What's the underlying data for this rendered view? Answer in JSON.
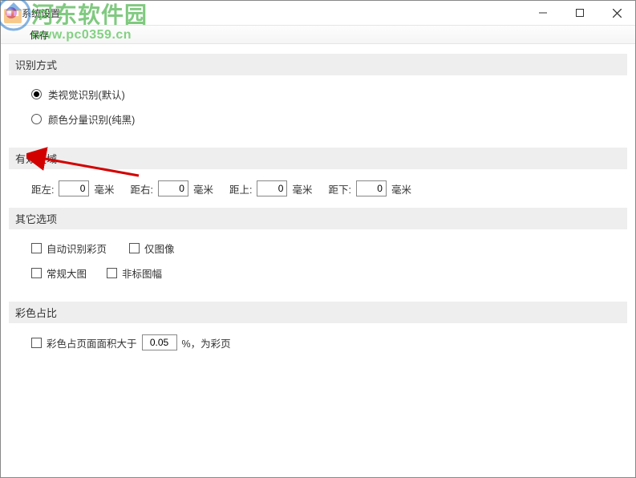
{
  "window": {
    "title": "系统设置"
  },
  "toolbar": {
    "save_label": "保存"
  },
  "sections": {
    "recognition": {
      "header": "识别方式",
      "opt_visual": "类视觉识别(默认)",
      "opt_color": "颜色分量识别(纯黑)"
    },
    "area": {
      "header": "有效区域",
      "lbl_left": "距左:",
      "val_left": "0",
      "lbl_right": "距右:",
      "val_right": "0",
      "lbl_top": "距上:",
      "val_top": "0",
      "lbl_bottom": "距下:",
      "val_bottom": "0",
      "unit": "毫米"
    },
    "other": {
      "header": "其它选项",
      "auto_color": "自动识别彩页",
      "image_only": "仅图像",
      "normal_big": "常规大图",
      "nonstd_frame": "非标图幅"
    },
    "ratio": {
      "header": "彩色占比",
      "prefix": "彩色占页面面积大于",
      "value": "0.05",
      "suffix": "%，为彩页"
    }
  },
  "watermark": {
    "site_name": "河东软件园",
    "url": "www.pc0359.cn"
  }
}
